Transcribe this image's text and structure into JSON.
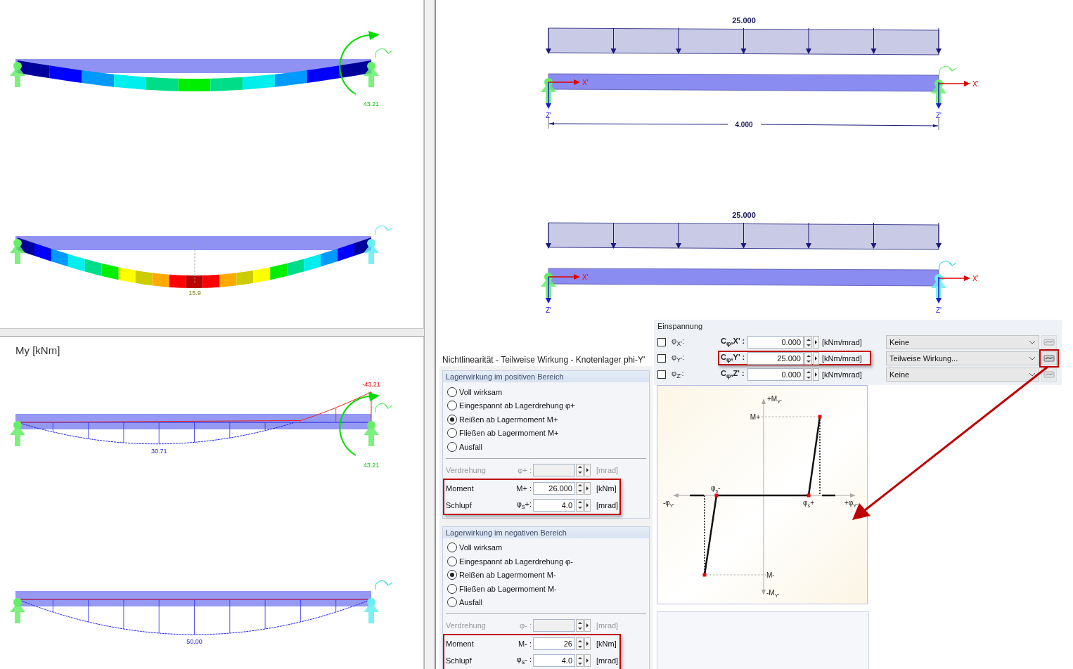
{
  "left_views": [
    {
      "beams": [
        {
          "kind": "deformation",
          "restrained": true,
          "end_moment": "43.21"
        },
        {
          "kind": "deformation",
          "restrained": false,
          "midspan_value": "15.9"
        }
      ]
    },
    {
      "title": "My [kNm]",
      "beams": [
        {
          "kind": "moment",
          "restrained": true,
          "midspan_value": "30.71",
          "end_value": "-43.21",
          "end_moment": "43.21"
        },
        {
          "kind": "moment",
          "restrained": false,
          "midspan_value": "50.00"
        }
      ]
    }
  ],
  "structure_views": [
    {
      "load": "25.000",
      "dimension": "4.000",
      "x_labels": [
        "X'",
        "X'"
      ],
      "z_labels": [
        "Z'",
        "Z'"
      ],
      "restrained": true
    },
    {
      "load": "25.000",
      "x_labels": [
        "X'",
        "X'"
      ],
      "z_labels": [
        "Z'",
        "Z'"
      ],
      "restrained": false
    }
  ],
  "dialog": {
    "title": "Nichtlinearität - Teilweise Wirkung - Knotenlager phi-Y'",
    "groups": [
      {
        "title": "Lagerwirkung im positiven Bereich",
        "options": [
          {
            "label": "Voll wirksam",
            "selected": false
          },
          {
            "label": "Eingespannt ab Lagerdrehung φ+",
            "selected": false
          },
          {
            "label": "Reißen ab Lagermoment M+",
            "selected": true
          },
          {
            "label": "Fließen ab Lagermoment M+",
            "selected": false
          },
          {
            "label": "Ausfall",
            "selected": false
          }
        ],
        "rows": [
          {
            "label": "Verdrehung",
            "symbol": "φ+ :",
            "unit": "[mrad]",
            "disabled": true,
            "highlighted": false
          },
          {
            "label": "Moment",
            "symbol": "M+ :",
            "value": "26.000",
            "unit": "[kNm]",
            "disabled": false,
            "highlighted": true
          },
          {
            "label": "Schlupf",
            "symbol": "φ$_{s}$+:",
            "value": "4.0",
            "unit": "[mrad]",
            "disabled": false,
            "highlighted": true
          }
        ]
      },
      {
        "title": "Lagerwirkung im negativen Bereich",
        "options": [
          {
            "label": "Voll wirksam",
            "selected": false
          },
          {
            "label": "Eingespannt ab Lagerdrehung φ-",
            "selected": false
          },
          {
            "label": "Reißen ab Lagermoment M-",
            "selected": true
          },
          {
            "label": "Fließen ab Lagermoment M-",
            "selected": false
          },
          {
            "label": "Ausfall",
            "selected": false
          }
        ],
        "rows": [
          {
            "label": "Verdrehung",
            "symbol": "φ- :",
            "unit": "[mrad]",
            "disabled": true,
            "highlighted": false
          },
          {
            "label": "Moment",
            "symbol": "M- :",
            "value": "26",
            "unit": "[kNm]",
            "disabled": false,
            "highlighted": true
          },
          {
            "label": "Schlupf",
            "symbol": "φ$_{s}$- :",
            "value": "4.0",
            "unit": "[mrad]",
            "disabled": false,
            "highlighted": true
          }
        ]
      }
    ]
  },
  "einspannung": {
    "title": "Einspannung",
    "rows": [
      {
        "checked": false,
        "axis": "φ$_{X'}$:",
        "c_label": "C$_{φ}$,X' :",
        "value": "0.000",
        "unit": "[kNm/mrad]",
        "dropdown": "Keine",
        "highlighted": false,
        "button_disabled": true,
        "button_highlighted": false
      },
      {
        "checked": false,
        "axis": "φ$_{Y'}$:",
        "c_label": "C$_{φ}$,Y' :",
        "value": "25.000",
        "unit": "[kNm/mrad]",
        "dropdown": "Teilweise Wirkung...",
        "highlighted": true,
        "button_disabled": false,
        "button_highlighted": true
      },
      {
        "checked": false,
        "axis": "φ$_{Z'}$:",
        "c_label": "C$_{φ}$,Z' :",
        "value": "0.000",
        "unit": "[kNm/mrad]",
        "dropdown": "Keine",
        "highlighted": false,
        "button_disabled": true,
        "button_highlighted": false
      }
    ]
  },
  "diagram": {
    "y_pos": "+M$_{Y'}$",
    "y_neg": "-M$_{Y'}$",
    "x_pos": "+φ$_{Y'}$",
    "x_neg": "-φ$_{Y'}$",
    "m_plus": "M+",
    "m_minus": "M-",
    "slip_pos": "φ$_{s}$+",
    "slip_neg": "φ$_{s}$-"
  }
}
